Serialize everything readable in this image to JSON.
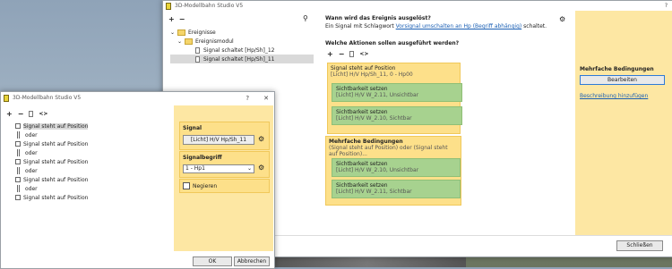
{
  "main_window": {
    "title": "3D-Modellbahn Studio V5",
    "help_glyph": "?",
    "close_glyph": "✕",
    "toolbar": {
      "add": "+",
      "remove": "−",
      "search_icon": "search-icon"
    },
    "tree": {
      "items": [
        {
          "label": "Ereignisse",
          "type": "folder"
        },
        {
          "label": "Ereignismodul",
          "type": "folder"
        },
        {
          "label": "Signal schaltet [Hp/Sh]_12",
          "type": "doc"
        },
        {
          "label": "Signal schaltet [Hp/Sh]_11",
          "type": "doc",
          "selected": true
        }
      ]
    },
    "trigger": {
      "heading": "Wann wird das Ereignis ausgelöst?",
      "text_prefix": "Ein Signal mit Schlagwort",
      "link": "Vorsignal umschalten an Hp (Begriff abhängig)",
      "text_suffix": "schaltet."
    },
    "actions": {
      "heading": "Welche Aktionen sollen ausgeführt werden?",
      "toolbar": {
        "add": "+",
        "remove": "−",
        "code": "<>"
      },
      "block1": {
        "title": "Signal steht auf Position",
        "sub": "[Licht] H/V Hp/Sh_11, 0 - Hp00",
        "items": [
          {
            "title": "Sichtbarkeit setzen",
            "sub": "[Licht] H/V W_2.11, Unsichtbar"
          },
          {
            "title": "Sichtbarkeit setzen",
            "sub": "[Licht] H/V W_2.10, Sichtbar"
          }
        ]
      },
      "block2": {
        "title": "Mehrfache Bedingungen",
        "sub": "(Signal steht auf Position) oder (Signal steht auf Position)...",
        "items": [
          {
            "title": "Sichtbarkeit setzen",
            "sub": "[Licht] H/V W_2.10, Unsichtbar"
          },
          {
            "title": "Sichtbarkeit setzen",
            "sub": "[Licht] H/V W_2.11, Sichtbar"
          }
        ]
      }
    },
    "right_panel": {
      "heading": "Mehrfache Bedingungen",
      "edit_button": "Bearbeiten",
      "description_link": "Beschreibung hinzufügen"
    },
    "close_button": "Schließen"
  },
  "dialog": {
    "title": "3D-Modellbahn Studio V5",
    "help_glyph": "?",
    "close_glyph": "✕",
    "toolbar": {
      "add": "+",
      "remove": "−",
      "code": "<>"
    },
    "list": [
      {
        "label": "Signal steht auf Position",
        "type": "item",
        "selected": true
      },
      {
        "label": "oder",
        "type": "or"
      },
      {
        "label": "Signal steht auf Position",
        "type": "item"
      },
      {
        "label": "oder",
        "type": "or"
      },
      {
        "label": "Signal steht auf Position",
        "type": "item"
      },
      {
        "label": "oder",
        "type": "or"
      },
      {
        "label": "Signal steht auf Position",
        "type": "item"
      },
      {
        "label": "oder",
        "type": "or"
      },
      {
        "label": "Signal steht auf Position",
        "type": "item"
      }
    ],
    "signal_label": "Signal",
    "signal_value": "[Licht] H/V Hp/Sh_11",
    "signalbegriff_label": "Signalbegriff",
    "signalbegriff_value": "1 - Hp1",
    "negieren_label": "Negieren",
    "ok_button": "OK",
    "cancel_button": "Abbrechen"
  },
  "colors": {
    "panel_yellow": "#fde08a",
    "item_green": "#a7d28f",
    "link_blue": "#1a5fb4"
  }
}
